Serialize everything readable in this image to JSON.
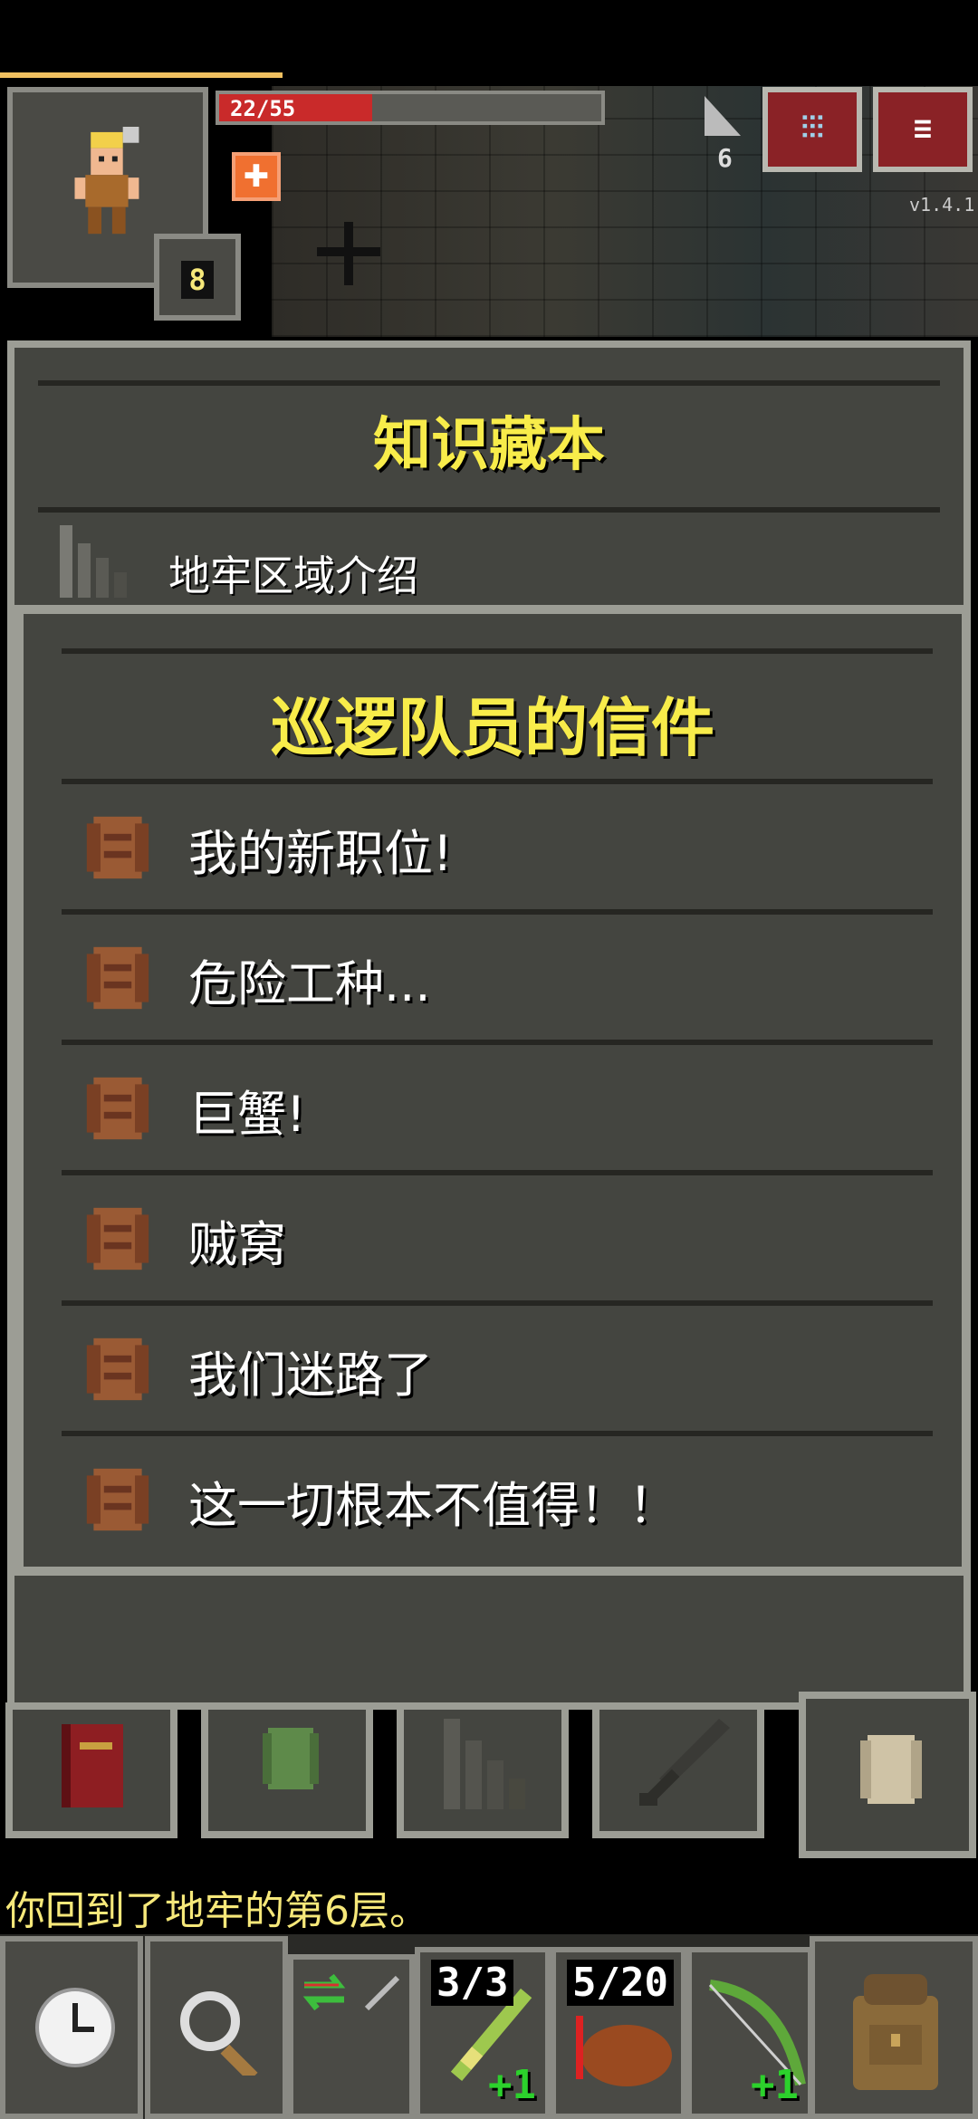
{
  "hud": {
    "hp_text": "22/55",
    "hp_fraction": 0.4,
    "hero_level": "8",
    "depth": "6",
    "version": "v1.4.1",
    "journal_button_glyph": "⫶⫶⫶",
    "menu_button_glyph": "≡"
  },
  "journal": {
    "title": "知识藏本",
    "category_label": "地牢区域介绍"
  },
  "letters": {
    "title": "巡逻队员的信件",
    "items": [
      {
        "label": "我的新职位!"
      },
      {
        "label": "危险工种..."
      },
      {
        "label": "巨蟹!"
      },
      {
        "label": "贼窝"
      },
      {
        "label": "我们迷路了"
      },
      {
        "label": "这一切根本不值得！！"
      }
    ]
  },
  "tabs": [
    "book-icon",
    "green-scroll-icon",
    "stairs-icon",
    "sword-icon",
    "letter-scroll-icon"
  ],
  "message": "你回到了地牢的第6层。",
  "toolbar": {
    "quickslots": [
      {
        "count": "3/3",
        "plus": "+1",
        "icon": "wand-icon"
      },
      {
        "count": "5/20",
        "plus": "",
        "icon": "darts-icon"
      },
      {
        "count": "",
        "plus": "+1",
        "icon": "bow-icon"
      }
    ]
  },
  "colors": {
    "title_yellow": "#f8ec4a",
    "panel": "#444540",
    "border": "#9c9d95",
    "hp_red": "#c92a2a",
    "message_yellow": "#f6e87a",
    "upgrade_green": "#2cd12c"
  }
}
